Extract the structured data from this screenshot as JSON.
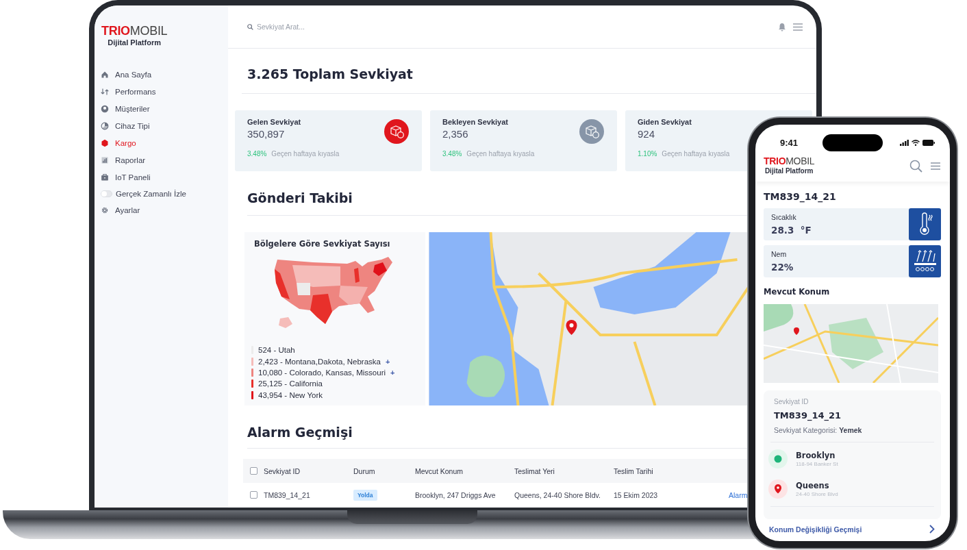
{
  "laptop": {
    "brand": {
      "name": "**TRIO**MOBIL",
      "tagline": "Dijital Platform"
    },
    "sidebar": {
      "items": [
        {
          "kind": "link",
          "label": "Ana Sayfa",
          "selected": false
        },
        {
          "kind": "link",
          "label": "Performans",
          "selected": false
        },
        {
          "kind": "link",
          "label": "Müşteriler",
          "selected": false
        },
        {
          "kind": "link",
          "label": "Cihaz Tipi",
          "selected": false
        },
        {
          "kind": "link",
          "label": "Kargo",
          "selected": true
        },
        {
          "kind": "link",
          "label": "Raporlar",
          "selected": false
        },
        {
          "kind": "link",
          "label": "IoT Paneli",
          "selected": false
        },
        {
          "kind": "toggle",
          "label": "Gerçek Zamanlı İzle",
          "on": false
        },
        {
          "kind": "link",
          "label": "Ayarlar",
          "selected": false
        }
      ]
    },
    "search": {
      "placeholder": "Sevkiyat Arat..."
    },
    "page_title": "3.265 Toplam Sevkiyat",
    "stats": [
      {
        "label": "Gelen Sevkiyat",
        "value": "350,897",
        "change": "3.48%",
        "note": "Geçen haftaya kıyasla",
        "color": "#e0161d"
      },
      {
        "label": "Bekleyen Sevkiyat",
        "value": "2,356",
        "change": "3.48%",
        "note": "Geçen haftaya kıyasla",
        "color": "#8795a8"
      },
      {
        "label": "Giden Sevkiyat",
        "value": "924",
        "change": "1.10%",
        "note": "Geçen haftaya kıyasla"
      }
    ],
    "tracking": {
      "title": "Gönderi Takibi",
      "region_panel": {
        "title": "Bölgelere Göre Sevkiyat Sayısı",
        "legend": [
          {
            "label": "524 - Utah",
            "color": "#ececec"
          },
          {
            "label": "2,423 - Montana,Dakota, Nebraska",
            "more": "+",
            "color": "#f5bcb9"
          },
          {
            "label": "10,080 - Colorado, Kansas, Missouri",
            "more": "+",
            "color": "#ee8580"
          },
          {
            "label": "25,125 - California",
            "color": "#e8302b"
          },
          {
            "label": "43,954 - New York",
            "color": "#e0111a"
          }
        ]
      }
    },
    "alarms": {
      "title": "Alarm Geçmişi",
      "header_checked": false,
      "columns": [
        "Sevkiyat ID",
        "Durum",
        "Mevcut Konum",
        "Teslimat Yeri",
        "Teslim Tarihi"
      ],
      "rows": [
        {
          "checked": false,
          "cells": [
            "TM839_14_21",
            "Yolda",
            "Brooklyn, 247 Driggs Ave",
            "Queens, 24-40 Shore Bldv.",
            "15 Ekim 2023"
          ],
          "action": "Alarm"
        }
      ]
    }
  },
  "phone": {
    "time": "9:41",
    "brand": {
      "name": "**TRIO**MOBIL",
      "tagline": "Dijital Platform"
    },
    "shipment_title": "TM839_14_21",
    "readings": [
      {
        "kind": "temperature",
        "label": "Sıcaklık",
        "value": "28.3  °F"
      },
      {
        "kind": "humidity",
        "label": "Nem",
        "value": "22%"
      }
    ],
    "location_title": "Mevcut Konum",
    "detail": {
      "id_label": "Sevkiyat ID",
      "id": "TM839_14_21",
      "category": "Sevkiyat Kategorisi: **Yemek**",
      "stops": [
        {
          "kind": "origin",
          "name": "Brooklyn",
          "address": "118-94 Banker St"
        },
        {
          "kind": "destination",
          "name": "Queens",
          "address": "24-40 Shore Blvd"
        }
      ]
    },
    "history_link": "Konum Değişikliği Geçmişi"
  }
}
